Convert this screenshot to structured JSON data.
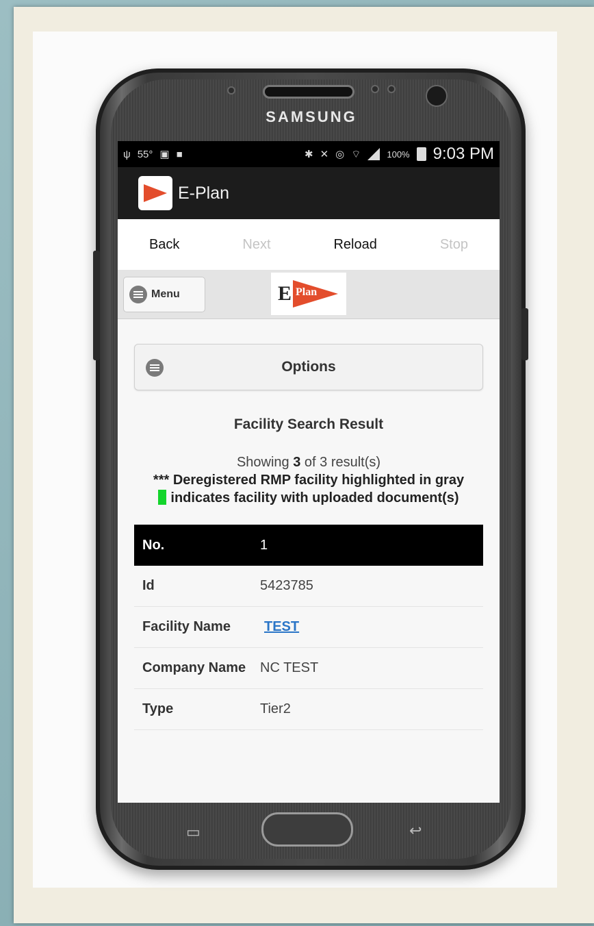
{
  "device": {
    "brand": "SAMSUNG"
  },
  "status_bar": {
    "left_icons": [
      "usb-icon",
      "temperature-icon",
      "image-icon",
      "bag-icon"
    ],
    "temperature": "55°",
    "right_icons": [
      "bluetooth-icon",
      "mute-icon",
      "alarm-icon",
      "wifi-icon",
      "signal-icon",
      "battery-icon"
    ],
    "battery_percent": "100%",
    "time": "9:03 PM"
  },
  "app_bar": {
    "title": "E-Plan"
  },
  "browser_nav": {
    "back_label": "Back",
    "next_label": "Next",
    "reload_label": "Reload",
    "stop_label": "Stop"
  },
  "header": {
    "menu_label": "Menu",
    "logo_letter": "E",
    "logo_word": "Plan"
  },
  "options": {
    "label": "Options"
  },
  "results": {
    "title": "Facility Search Result",
    "showing_prefix": "Showing ",
    "shown_count": "3",
    "showing_suffix": " of 3 result(s)",
    "deregistered_note": "*** Deregistered RMP facility highlighted in gray",
    "uploaded_note": "indicates facility with uploaded document(s)",
    "indicator_color": "#14d52c"
  },
  "table": {
    "rows": [
      {
        "key": "No.",
        "value": "1"
      },
      {
        "key": "Id",
        "value": "5423785"
      },
      {
        "key": "Facility Name",
        "value": "TEST"
      },
      {
        "key": "Company Name",
        "value": "NC TEST"
      },
      {
        "key": "Type",
        "value": "Tier2"
      }
    ]
  },
  "colors": {
    "accent": "#e34d2c",
    "link": "#2a75c7",
    "header_row": "#000000"
  }
}
